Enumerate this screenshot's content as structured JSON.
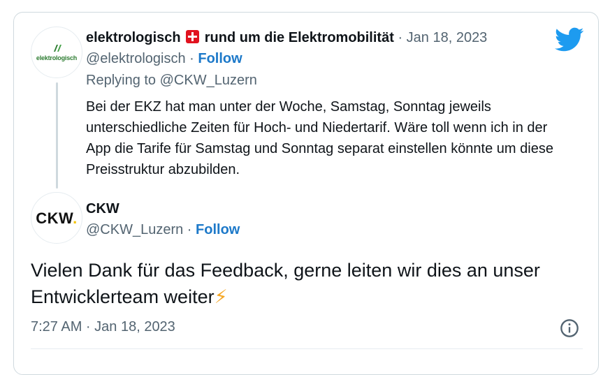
{
  "reply_tweet": {
    "avatar_text": "elektrologisch",
    "display_name_part1": "elektrologisch",
    "flag_icon": "swiss-flag-icon",
    "display_name_part2": "rund um die Elektromobilität",
    "date_text": "· Jan 18, 2023",
    "handle_text": "@elektrologisch ·",
    "follow_label": "Follow",
    "replying_to": "Replying to @CKW_Luzern",
    "text": "Bei der EKZ hat man unter der Woche, Samstag, Sonntag jeweils unterschiedliche Zeiten für Hoch- und Niedertarif. Wäre toll wenn ich in der App die Tarife für Samstag und Sonntag separat einstellen könnte um diese Preisstruktur abzubilden."
  },
  "main_tweet": {
    "avatar_text": "CKW",
    "avatar_dot": ".",
    "display_name": "CKW",
    "handle_text": "@CKW_Luzern ·",
    "follow_label": "Follow",
    "text": "Vielen Dank für das Feedback, gerne leiten wir dies an unser Entwicklerteam weiter",
    "emoji": "⚡",
    "timestamp": "7:27 AM · Jan 18, 2023"
  },
  "icons": {
    "brand": "twitter-bird-icon",
    "info": "info-icon",
    "flag": "swiss-flag-icon"
  },
  "colors": {
    "accent": "#1d9bf0",
    "follow": "#1d79c9",
    "muted": "#536471",
    "text": "#0f1419",
    "border": "#cfd9de",
    "flag": "#e1121f",
    "bolt": "#f5a623"
  }
}
